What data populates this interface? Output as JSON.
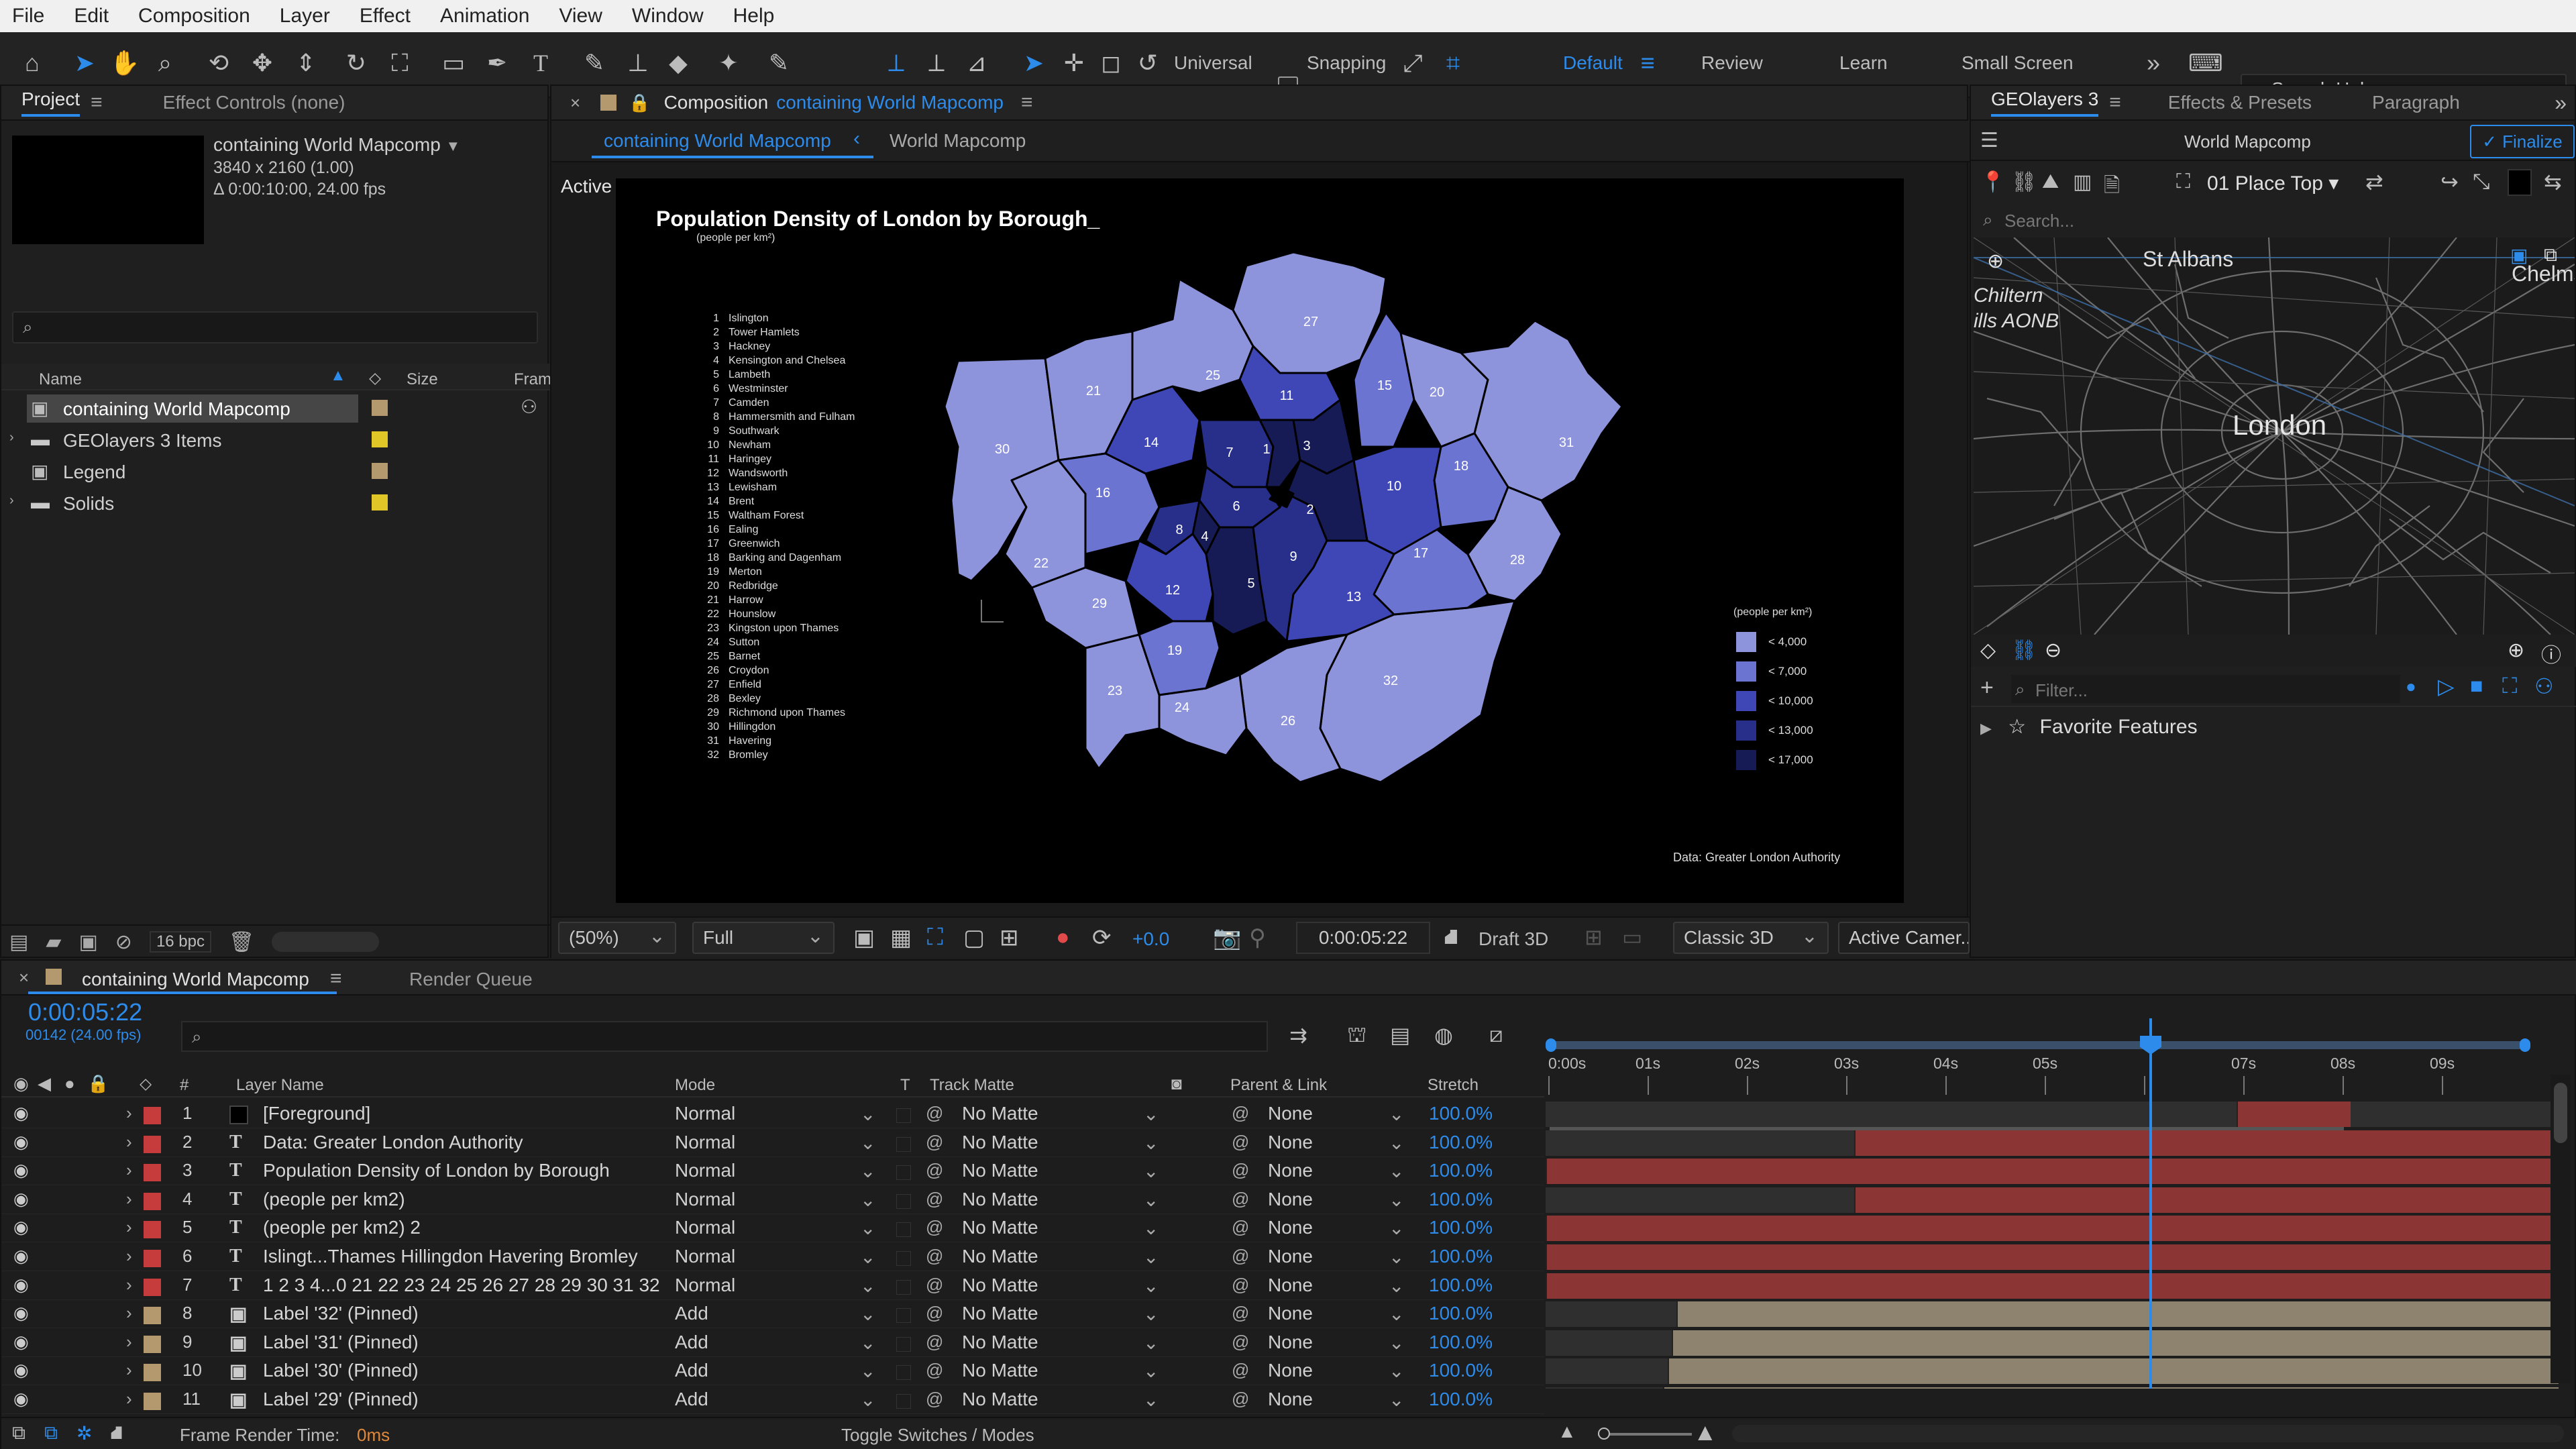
{
  "menu": [
    "File",
    "Edit",
    "Composition",
    "Layer",
    "Effect",
    "Animation",
    "View",
    "Window",
    "Help"
  ],
  "toolbar": {
    "universal_label": "Universal",
    "snapping_label": "Snapping",
    "workspaces": [
      "Default",
      "Review",
      "Learn",
      "Small Screen"
    ],
    "active_workspace": "Default",
    "search_placeholder": "Search Help"
  },
  "project_panel": {
    "tabs": [
      "Project",
      "Effect Controls (none)"
    ],
    "comp_name": "containing World Mapcomp",
    "comp_res": "3840 x 2160 (1.00)",
    "comp_dur": "Δ 0:00:10:00, 24.00 fps",
    "columns": {
      "name": "Name",
      "size": "Size",
      "frame": "Fram"
    },
    "items": [
      {
        "name": "containing World Mapcomp",
        "type": "comp",
        "color": "#b4986e",
        "selected": true
      },
      {
        "name": "GEOlayers 3 Items",
        "type": "folder",
        "color": "#e0c626"
      },
      {
        "name": "Legend",
        "type": "comp",
        "color": "#b4986e"
      },
      {
        "name": "Solids",
        "type": "folder",
        "color": "#e0c626"
      }
    ],
    "bpc": "16 bpc"
  },
  "comp_panel": {
    "label": "Composition",
    "comp_name": "containing World Mapcomp",
    "breadcrumbs": [
      "containing World Mapcomp",
      "World Mapcomp"
    ],
    "camera": "Active Camera (Default)",
    "zoom": "(50%)",
    "resolution": "Full",
    "exposure": "+0.0",
    "timecode": "0:00:05:22",
    "draft3d": "Draft 3D",
    "renderer": "Classic 3D",
    "view": "Active Camer..."
  },
  "map": {
    "title": "Population Density of London by Borough_",
    "subtitle": "(people per km²)",
    "boroughs": [
      "Islington",
      "Tower Hamlets",
      "Hackney",
      "Kensington and Chelsea",
      "Lambeth",
      "Westminster",
      "Camden",
      "Hammersmith and Fulham",
      "Southwark",
      "Newham",
      "Haringey",
      "Wandsworth",
      "Lewisham",
      "Brent",
      "Waltham Forest",
      "Ealing",
      "Greenwich",
      "Barking and Dagenham",
      "Merton",
      "Redbridge",
      "Harrow",
      "Hounslow",
      "Kingston upon Thames",
      "Sutton",
      "Barnet",
      "Croydon",
      "Enfield",
      "Bexley",
      "Richmond upon Thames",
      "Hillingdon",
      "Havering",
      "Bromley"
    ],
    "legend_title": "(people per km²)",
    "legend": [
      {
        "label": "< 4,000",
        "color": "#8e94dc"
      },
      {
        "label": "< 7,000",
        "color": "#6c74d2"
      },
      {
        "label": "< 10,000",
        "color": "#3f47b6"
      },
      {
        "label": "< 13,000",
        "color": "#272f8a"
      },
      {
        "label": "< 17,000",
        "color": "#161b55"
      }
    ],
    "source": "Data: Greater London Authority"
  },
  "geo_panel": {
    "tabs": [
      "GEOlayers 3",
      "Effects & Presets",
      "Paragraph"
    ],
    "map_name": "World Mapcomp",
    "finalize": "Finalize",
    "place_mode": "01 Place Top",
    "search_placeholder": "Search...",
    "map_labels": [
      "St Albans",
      "Chelms",
      "Chiltern",
      "ills AONB",
      "London"
    ],
    "filter_placeholder": "Filter...",
    "favorites": "Favorite Features"
  },
  "timeline": {
    "tabs": [
      "containing World Mapcomp",
      "Render Queue"
    ],
    "timecode": "0:00:05:22",
    "frame_info": "00142 (24.00 fps)",
    "columns": {
      "layer": "Layer Name",
      "mode": "Mode",
      "t": "T",
      "matte": "Track Matte",
      "parent": "Parent & Link",
      "stretch": "Stretch"
    },
    "ruler": [
      "0:00s",
      "01s",
      "02s",
      "03s",
      "04s",
      "05s",
      "",
      "07s",
      "08s",
      "09s"
    ],
    "layers": [
      {
        "num": "1",
        "type": "solid",
        "name": "[Foreground]",
        "mode": "Normal",
        "matte": "No Matte",
        "parent": "None",
        "stretch": "100.0%",
        "color": "#c63c3c"
      },
      {
        "num": "2",
        "type": "text",
        "name": "Data: Greater London Authority",
        "mode": "Normal",
        "matte": "No Matte",
        "parent": "None",
        "stretch": "100.0%",
        "color": "#c63c3c"
      },
      {
        "num": "3",
        "type": "text",
        "name": "Population Density of London by Borough",
        "mode": "Normal",
        "matte": "No Matte",
        "parent": "None",
        "stretch": "100.0%",
        "color": "#c63c3c"
      },
      {
        "num": "4",
        "type": "text",
        "name": "(people per km2)",
        "mode": "Normal",
        "matte": "No Matte",
        "parent": "None",
        "stretch": "100.0%",
        "color": "#c63c3c"
      },
      {
        "num": "5",
        "type": "text",
        "name": "(people per km2) 2",
        "mode": "Normal",
        "matte": "No Matte",
        "parent": "None",
        "stretch": "100.0%",
        "color": "#c63c3c"
      },
      {
        "num": "6",
        "type": "text",
        "name": "Islingt...Thames Hillingdon Havering Bromley",
        "mode": "Normal",
        "matte": "No Matte",
        "parent": "None",
        "stretch": "100.0%",
        "color": "#c63c3c"
      },
      {
        "num": "7",
        "type": "text",
        "name": "1 2 3 4...0 21 22 23 24 25 26 27 28 29 30 31 32",
        "mode": "Normal",
        "matte": "No Matte",
        "parent": "None",
        "stretch": "100.0%",
        "color": "#c63c3c"
      },
      {
        "num": "8",
        "type": "comp",
        "name": "Label '32' (Pinned)",
        "mode": "Add",
        "matte": "No Matte",
        "parent": "None",
        "stretch": "100.0%",
        "color": "#b4986e"
      },
      {
        "num": "9",
        "type": "comp",
        "name": "Label '31' (Pinned)",
        "mode": "Add",
        "matte": "No Matte",
        "parent": "None",
        "stretch": "100.0%",
        "color": "#b4986e"
      },
      {
        "num": "10",
        "type": "comp",
        "name": "Label '30' (Pinned)",
        "mode": "Add",
        "matte": "No Matte",
        "parent": "None",
        "stretch": "100.0%",
        "color": "#b4986e"
      },
      {
        "num": "11",
        "type": "comp",
        "name": "Label '29' (Pinned)",
        "mode": "Add",
        "matte": "No Matte",
        "parent": "None",
        "stretch": "100.0%",
        "color": "#b4986e"
      }
    ],
    "footer_render_label": "Frame Render Time:",
    "footer_render_value": "0ms",
    "footer_toggle": "Toggle Switches / Modes"
  }
}
